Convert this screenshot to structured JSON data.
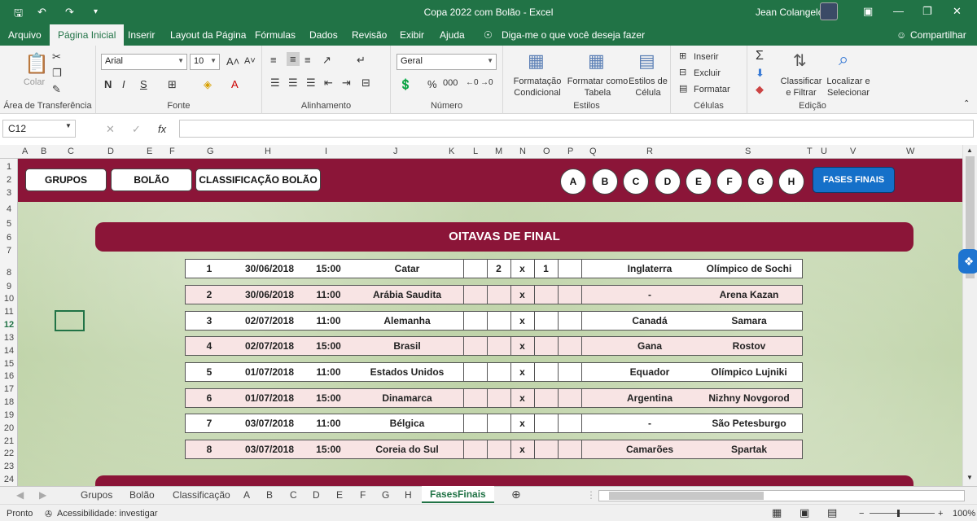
{
  "title_bar": {
    "title": "Copa 2022 com Bolão  -  Excel",
    "user": "Jean Colangelo",
    "save_icon": "save-icon",
    "undo_icon": "undo-icon",
    "redo_icon": "redo-icon"
  },
  "ribbon_tabs": [
    {
      "label": "Arquivo"
    },
    {
      "label": "Página Inicial"
    },
    {
      "label": "Inserir"
    },
    {
      "label": "Layout da Página"
    },
    {
      "label": "Fórmulas"
    },
    {
      "label": "Dados"
    },
    {
      "label": "Revisão"
    },
    {
      "label": "Exibir"
    },
    {
      "label": "Ajuda"
    }
  ],
  "tell_me": "Diga-me o que você deseja fazer",
  "share": "Compartilhar",
  "ribbon": {
    "clipboard": {
      "label": "Área de Transferência",
      "paste": "Colar"
    },
    "font": {
      "label": "Fonte",
      "name": "Arial",
      "size": "10",
      "bold": "N",
      "italic": "I",
      "underline": "S"
    },
    "alignment": {
      "label": "Alinhamento"
    },
    "number": {
      "label": "Número",
      "format": "Geral",
      "percent": "%",
      "thousands": "000"
    },
    "styles": {
      "label": "Estilos",
      "cond": "Formatação\nCondicional",
      "table": "Formatar como\nTabela",
      "cell": "Estilos de\nCélula"
    },
    "cells": {
      "label": "Células",
      "insert": "Inserir",
      "delete": "Excluir",
      "format": "Formatar"
    },
    "editing": {
      "label": "Edição",
      "sort": "Classificar\ne Filtrar",
      "find": "Localizar e\nSelecionar"
    }
  },
  "formula_bar": {
    "name_box": "C12",
    "fx": "fx"
  },
  "columns": [
    "A",
    "B",
    "C",
    "D",
    "E",
    "F",
    "G",
    "H",
    "I",
    "J",
    "K",
    "L",
    "M",
    "N",
    "O",
    "P",
    "Q",
    "R",
    "S",
    "T",
    "U",
    "V",
    "W"
  ],
  "rows": [
    "1",
    "2",
    "3",
    "4",
    "5",
    "6",
    "7",
    "8",
    "9",
    "10",
    "11",
    "12",
    "13",
    "14",
    "15",
    "16",
    "17",
    "18",
    "19",
    "20",
    "21",
    "22",
    "23",
    "24"
  ],
  "nav_buttons": [
    "GRUPOS",
    "BOLÃO",
    "CLASSIFICAÇÃO BOLÃO"
  ],
  "group_buttons": [
    "A",
    "B",
    "C",
    "D",
    "E",
    "F",
    "G",
    "H"
  ],
  "finals_button": "FASES FINAIS",
  "stage_title": "OITAVAS DE FINAL",
  "matches": [
    {
      "num": "1",
      "date": "30/06/2018",
      "time": "15:00",
      "home": "Catar",
      "sh": "2",
      "x": "x",
      "sa": "1",
      "away": "Inglaterra",
      "venue": "Olímpico de Sochi"
    },
    {
      "num": "2",
      "date": "30/06/2018",
      "time": "11:00",
      "home": "Arábia Saudita",
      "sh": "",
      "x": "x",
      "sa": "",
      "away": "-",
      "venue": "Arena Kazan"
    },
    {
      "num": "3",
      "date": "02/07/2018",
      "time": "11:00",
      "home": "Alemanha",
      "sh": "",
      "x": "x",
      "sa": "",
      "away": "Canadá",
      "venue": "Samara"
    },
    {
      "num": "4",
      "date": "02/07/2018",
      "time": "15:00",
      "home": "Brasil",
      "sh": "",
      "x": "x",
      "sa": "",
      "away": "Gana",
      "venue": "Rostov"
    },
    {
      "num": "5",
      "date": "01/07/2018",
      "time": "11:00",
      "home": "Estados Unidos",
      "sh": "",
      "x": "x",
      "sa": "",
      "away": "Equador",
      "venue": "Olímpico Lujniki"
    },
    {
      "num": "6",
      "date": "01/07/2018",
      "time": "15:00",
      "home": "Dinamarca",
      "sh": "",
      "x": "x",
      "sa": "",
      "away": "Argentina",
      "venue": "Nizhny Novgorod"
    },
    {
      "num": "7",
      "date": "03/07/2018",
      "time": "11:00",
      "home": "Bélgica",
      "sh": "",
      "x": "x",
      "sa": "",
      "away": "-",
      "venue": "São Petesburgo"
    },
    {
      "num": "8",
      "date": "03/07/2018",
      "time": "15:00",
      "home": "Coreia do Sul",
      "sh": "",
      "x": "x",
      "sa": "",
      "away": "Camarões",
      "venue": "Spartak"
    }
  ],
  "sheet_tabs": [
    "Grupos",
    "Bolão",
    "Classificação",
    "A",
    "B",
    "C",
    "D",
    "E",
    "F",
    "G",
    "H",
    "FasesFinais"
  ],
  "active_sheet": "FasesFinais",
  "status": {
    "ready": "Pronto",
    "accessibility": "Acessibilidade: investigar",
    "zoom": "100%"
  }
}
